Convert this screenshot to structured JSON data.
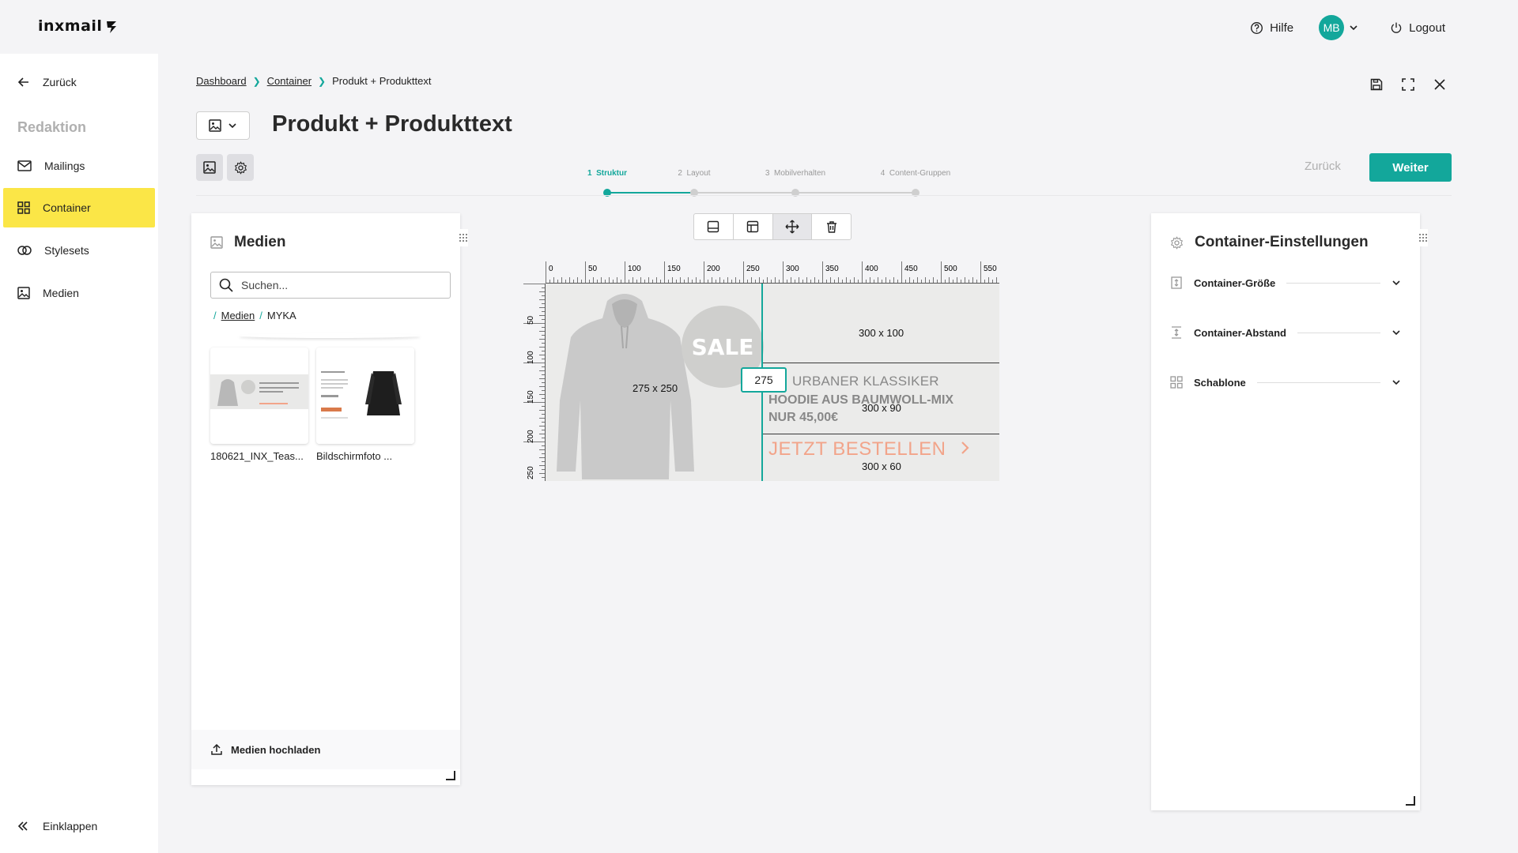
{
  "app": {
    "logo_text": "INXMAIL"
  },
  "topbar": {
    "help_label": "Hilfe",
    "avatar_initials": "MB",
    "logout_label": "Logout"
  },
  "sidebar": {
    "back_label": "Zurück",
    "section_label": "Redaktion",
    "items": [
      {
        "label": "Mailings",
        "icon": "mail-icon",
        "active": false
      },
      {
        "label": "Container",
        "icon": "grid-icon",
        "active": true
      },
      {
        "label": "Stylesets",
        "icon": "palette-icon",
        "active": false
      },
      {
        "label": "Medien",
        "icon": "image-icon",
        "active": false
      }
    ],
    "collapse_label": "Einklappen"
  },
  "breadcrumb": [
    "Dashboard",
    "Container",
    "Produkt + Produkttext"
  ],
  "page": {
    "title": "Produkt + Produkttext"
  },
  "steps": [
    {
      "num": "1",
      "label": "Struktur",
      "active": true
    },
    {
      "num": "2",
      "label": "Layout",
      "active": false
    },
    {
      "num": "3",
      "label": "Mobilverhalten",
      "active": false
    },
    {
      "num": "4",
      "label": "Content-Gruppen",
      "active": false
    }
  ],
  "actions": {
    "back_label": "Zurück",
    "next_label": "Weiter"
  },
  "media_panel": {
    "title": "Medien",
    "search_placeholder": "Suchen...",
    "path": [
      "Medien",
      "MYKA"
    ],
    "files": [
      {
        "name": "180621_INX_Teas..."
      },
      {
        "name": "Bildschirmfoto ..."
      }
    ],
    "upload_label": "Medien hochladen"
  },
  "settings_panel": {
    "title": "Container-Einstellungen",
    "sections": [
      {
        "label": "Container-Größe",
        "icon": "size-icon"
      },
      {
        "label": "Container-Abstand",
        "icon": "spacing-icon"
      },
      {
        "label": "Schablone",
        "icon": "template-icon"
      }
    ]
  },
  "canvas": {
    "ruler_x": [
      "0",
      "50",
      "100",
      "150",
      "200",
      "250",
      "300",
      "350",
      "400",
      "450",
      "500",
      "550"
    ],
    "ruler_y": [
      "50",
      "100",
      "150",
      "200",
      "250"
    ],
    "cells": {
      "image": "275 x 250",
      "top": "300 x 100",
      "middle": "300 x 90",
      "bottom": "300 x 60"
    },
    "sale_label": "SALE",
    "subtitle": "URBANER KLASSIKER",
    "product_line1": "HOODIE AUS BAUMWOLL-MIX",
    "product_line2": "NUR 45,00€",
    "cta": "JETZT BESTELLEN",
    "width_input_value": "275"
  },
  "colors": {
    "accent": "#13a79b",
    "active_nav": "#fbe647",
    "cta": "#f2a48a"
  }
}
